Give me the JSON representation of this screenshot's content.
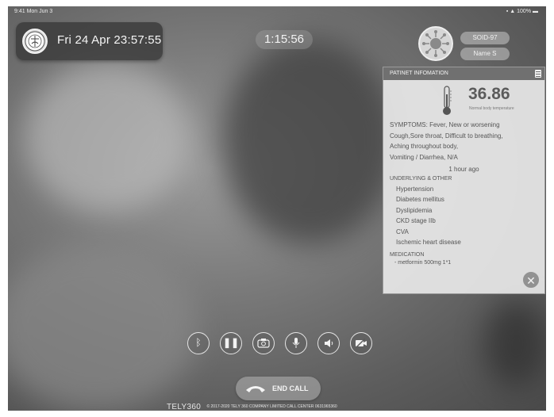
{
  "status_bar": {
    "left": "9:41 Mon Jun 3",
    "right": "100%"
  },
  "header": {
    "datetime": "Fri 24 Apr 23:57:55",
    "call_timer": "1:15:56"
  },
  "patient": {
    "sid": "SOID-97",
    "name": "Name S"
  },
  "panel": {
    "title": "PATINET INFOMATION",
    "temperature": "36.86",
    "temperature_note": "Normal body temperature",
    "symptoms_lines": [
      "SYMPTOMS: Fever, New or worsening",
      "Cough,Sore throat, Difficult to breathing,",
      "Aching throughout body,",
      "Vomiting / Diarrhea, N/A"
    ],
    "time_ago": "1 hour ago",
    "underlying_heading": "UNDERLYING & OTHER",
    "conditions": [
      "Hypertension",
      "Diabetes mellitus",
      "Dyslipidemia",
      "CKD stage IIb",
      "CVA",
      "Ischemic heart disease"
    ],
    "medication_heading": "MEDICATION",
    "medication_item": "- metformin 500mg 1*1"
  },
  "controls": {
    "end_call_label": "END CALL"
  },
  "footer": {
    "brand": "TELY360",
    "copyright": "© 2017-2020 TELY 360 COMPANY LIMITED CALL CENTER 0631965360"
  },
  "colors": {
    "panel_header": "#707070",
    "panel_bg": "#ebebeb",
    "screen_bg": "#7b7b7b"
  }
}
